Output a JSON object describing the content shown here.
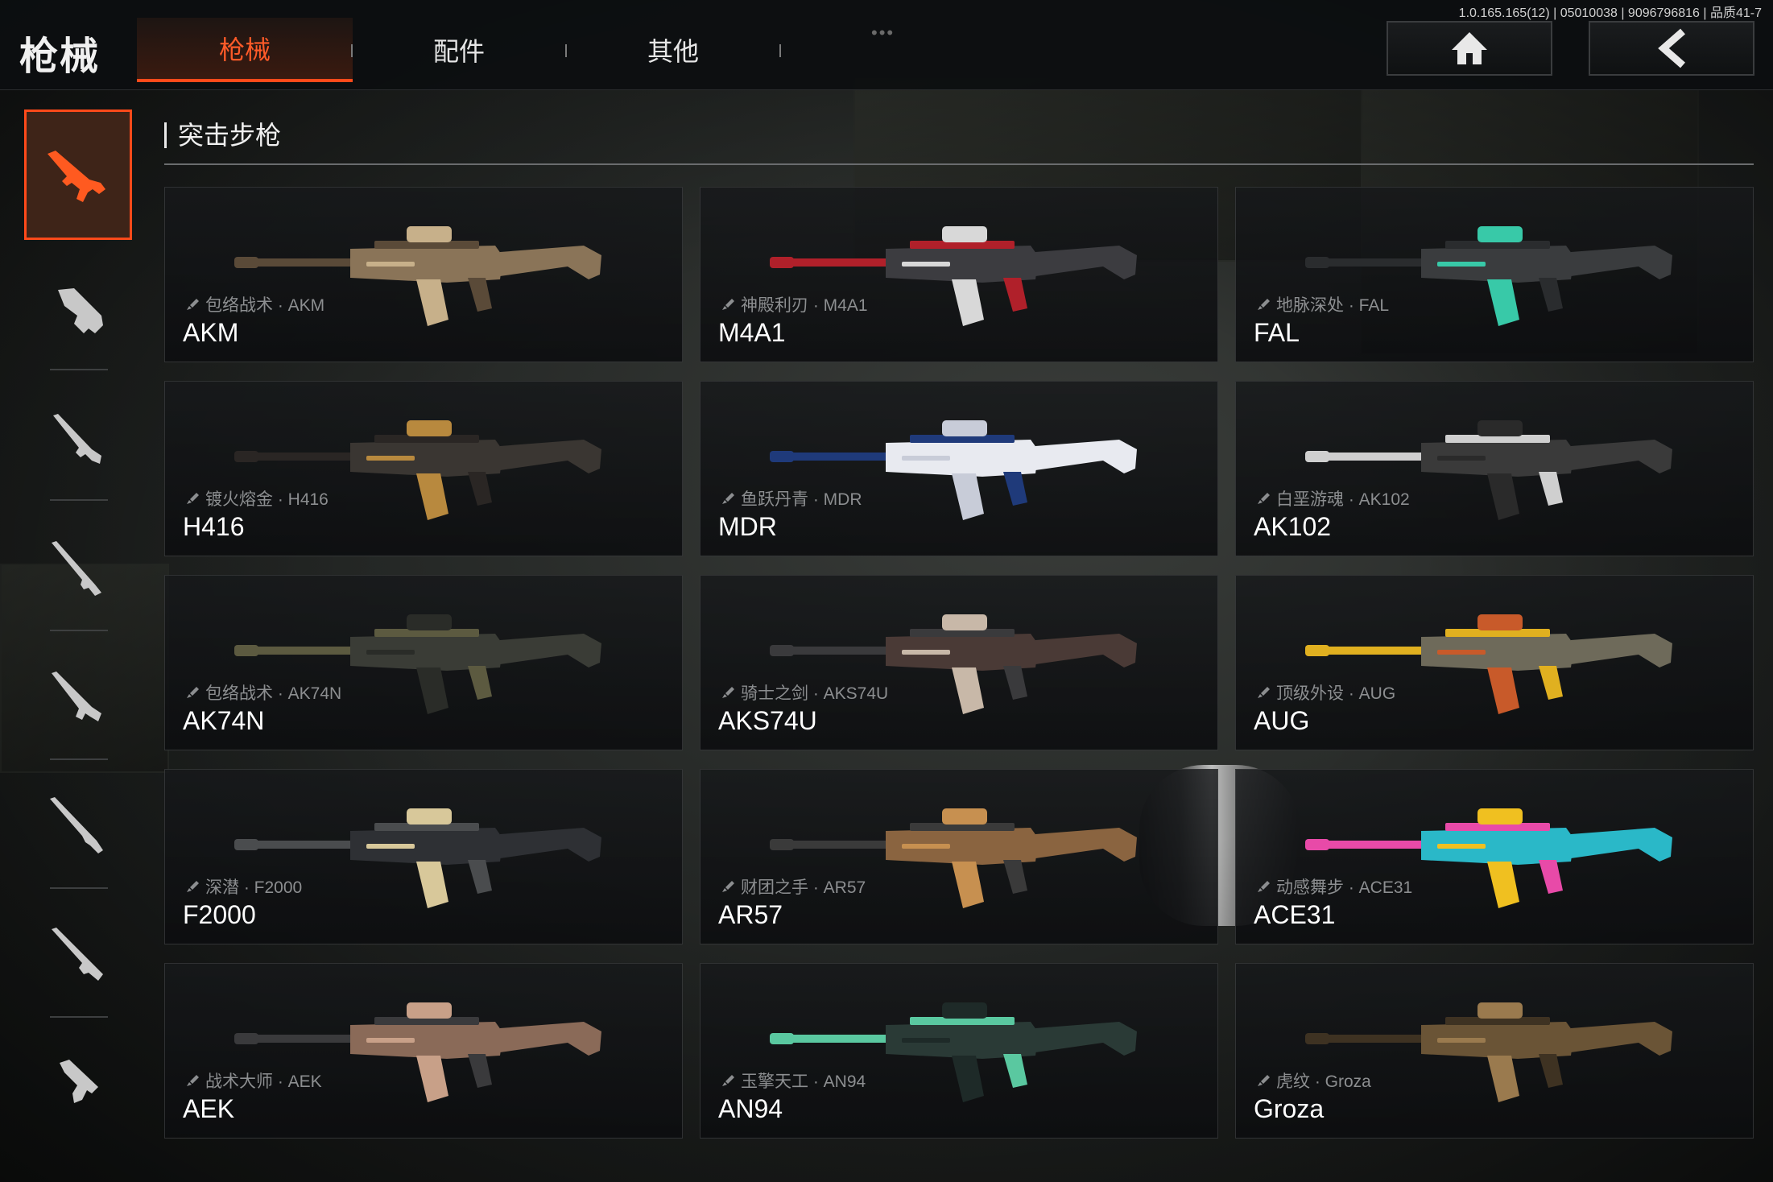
{
  "app": {
    "title": "枪械",
    "version": "1.0.165.165(12) | 05010038 | 9096796816 | 品质41-7"
  },
  "tabs": [
    {
      "label": "枪械",
      "active": true
    },
    {
      "label": "配件",
      "active": false
    },
    {
      "label": "其他",
      "active": false
    }
  ],
  "nav": {
    "home_icon": "home-icon",
    "back_icon": "back-arrow-icon"
  },
  "sidebar": {
    "categories": [
      {
        "icon": "assault-rifle-icon",
        "active": true
      },
      {
        "icon": "smg-icon",
        "active": false
      },
      {
        "icon": "shotgun-icon",
        "active": false
      },
      {
        "icon": "marksman-rifle-icon",
        "active": false
      },
      {
        "icon": "lmg-icon",
        "active": false
      },
      {
        "icon": "sniper-rifle-icon",
        "active": false
      },
      {
        "icon": "special-weapon-icon",
        "active": false
      },
      {
        "icon": "pistol-icon",
        "active": false
      }
    ]
  },
  "section": {
    "title": "突击步枪"
  },
  "weapons": [
    {
      "skin": "包络战术 · AKM",
      "name": "AKM",
      "colors": [
        "#8a7458",
        "#5a4a38",
        "#c7b08a"
      ]
    },
    {
      "skin": "神殿利刃 · M4A1",
      "name": "M4A1",
      "colors": [
        "#3c3c40",
        "#b0202a",
        "#d8d8d8"
      ]
    },
    {
      "skin": "地脉深处 · FAL",
      "name": "FAL",
      "colors": [
        "#3a3c3e",
        "#2a2c2e",
        "#38c9a8"
      ]
    },
    {
      "skin": "镀火熔金 · H416",
      "name": "H416",
      "colors": [
        "#3a3632",
        "#2a2624",
        "#b8893e"
      ]
    },
    {
      "skin": "鱼跃丹青 · MDR",
      "name": "MDR",
      "colors": [
        "#e8eaf0",
        "#1f3a7a",
        "#c8ccd8"
      ]
    },
    {
      "skin": "白垩游魂 · AK102",
      "name": "AK102",
      "colors": [
        "#3a3a3a",
        "#cfcfcf",
        "#2a2a2a"
      ]
    },
    {
      "skin": "包络战术 · AK74N",
      "name": "AK74N",
      "colors": [
        "#3a3c36",
        "#5c5a40",
        "#2a2c28"
      ]
    },
    {
      "skin": "骑士之剑 · AKS74U",
      "name": "AKS74U",
      "colors": [
        "#4a3a36",
        "#3a3a3c",
        "#c8b8a8"
      ]
    },
    {
      "skin": "顶级外设 · AUG",
      "name": "AUG",
      "colors": [
        "#6e6a5a",
        "#e0b020",
        "#c85a2a"
      ]
    },
    {
      "skin": "深潜 · F2000",
      "name": "F2000",
      "colors": [
        "#2e3034",
        "#4a4c4e",
        "#d8c89a"
      ]
    },
    {
      "skin": "财团之手 · AR57",
      "name": "AR57",
      "colors": [
        "#8a6440",
        "#3a3a3a",
        "#c79050"
      ]
    },
    {
      "skin": "动感舞步 · ACE31",
      "name": "ACE31",
      "colors": [
        "#2ab8c8",
        "#e84aa8",
        "#f0c020"
      ]
    },
    {
      "skin": "战术大师 · AEK",
      "name": "AEK",
      "colors": [
        "#8a6a58",
        "#3a3a3c",
        "#c8a088"
      ]
    },
    {
      "skin": "玉擎天工 · AN94",
      "name": "AN94",
      "colors": [
        "#2a3a36",
        "#5ac8a0",
        "#1e2a28"
      ]
    },
    {
      "skin": "虎纹 · Groza",
      "name": "Groza",
      "colors": [
        "#6a5436",
        "#3e3222",
        "#9a7a4e"
      ]
    }
  ]
}
